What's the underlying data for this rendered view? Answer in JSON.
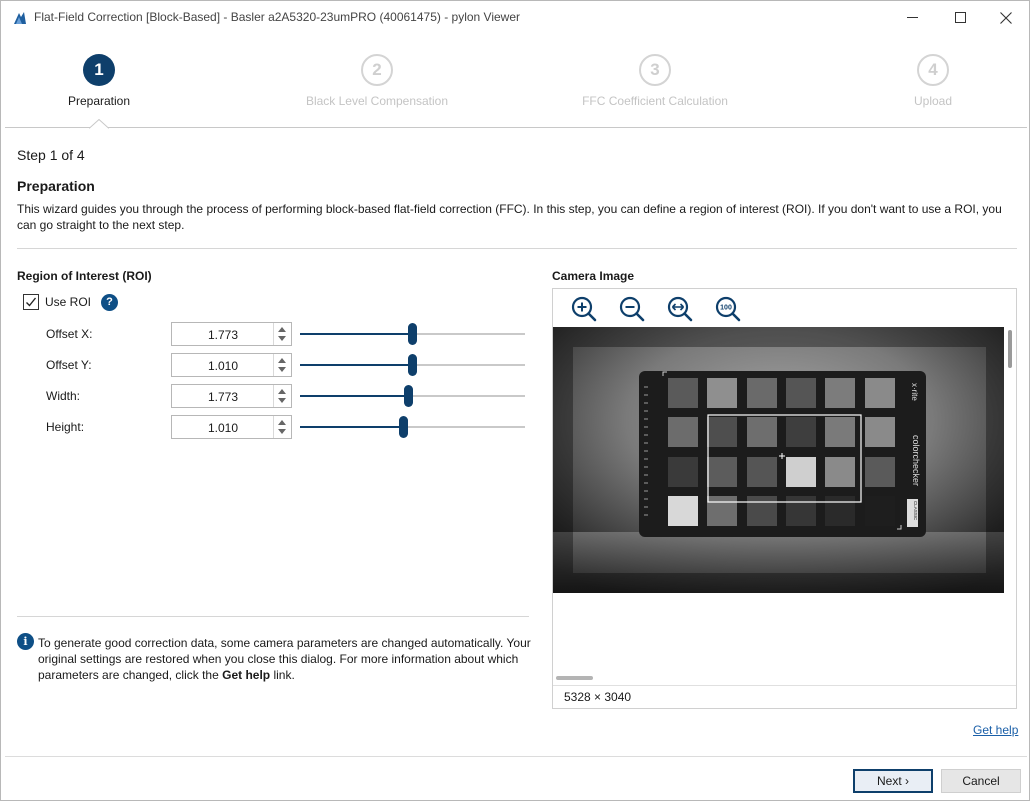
{
  "window": {
    "title": "Flat-Field Correction [Block-Based] - Basler a2A5320-23umPRO (40061475) - pylon Viewer",
    "icons": [
      "app-icon",
      "minimize-icon",
      "maximize-icon",
      "close-icon"
    ]
  },
  "steps": [
    {
      "number": "1",
      "label": "Preparation",
      "state": "active"
    },
    {
      "number": "2",
      "label": "Black Level Compensation",
      "state": "inactive"
    },
    {
      "number": "3",
      "label": "FFC Coefficient Calculation",
      "state": "inactive"
    },
    {
      "number": "4",
      "label": "Upload",
      "state": "inactive"
    }
  ],
  "page": {
    "step_counter": "Step 1 of 4",
    "title": "Preparation",
    "intro": "This wizard guides you through the process of performing block-based flat-field correction (FFC). In this step, you can define a region of interest (ROI). If you don't want to use a ROI, you can go straight to the next step."
  },
  "roi": {
    "title": "Region of Interest (ROI)",
    "use_roi_label": "Use ROI",
    "use_roi_checked": true,
    "help_glyph": "?",
    "params": [
      {
        "label": "Offset X:",
        "value": "1.773",
        "slider_fraction": 0.5
      },
      {
        "label": "Offset Y:",
        "value": "1.010",
        "slider_fraction": 0.5
      },
      {
        "label": "Width:",
        "value": "1.773",
        "slider_fraction": 0.48
      },
      {
        "label": "Height:",
        "value": "1.010",
        "slider_fraction": 0.46
      }
    ]
  },
  "info": {
    "icon_glyph": "i",
    "text_before": "To generate good correction data, some camera parameters are changed automatically. Your original settings are restored when you close this dialog. For more information about which parameters are changed, click the ",
    "text_bold": "Get help",
    "text_after": " link."
  },
  "camera": {
    "title": "Camera Image",
    "tools": [
      "zoom-in-icon",
      "zoom-out-icon",
      "fit-width-icon",
      "zoom-100-icon"
    ],
    "zoom_100_label": "100",
    "dimensions": "5328 × 3040",
    "target_brand": "x·rite",
    "target_name": "colorchecker",
    "target_badge": "CLASSIC"
  },
  "links": {
    "get_help": "Get help"
  },
  "buttons": {
    "next": "Next ›",
    "cancel": "Cancel"
  },
  "colors": {
    "accent": "#0e3f6b",
    "link": "#1a5fa8",
    "inactive_step": "#c4c4c4"
  }
}
